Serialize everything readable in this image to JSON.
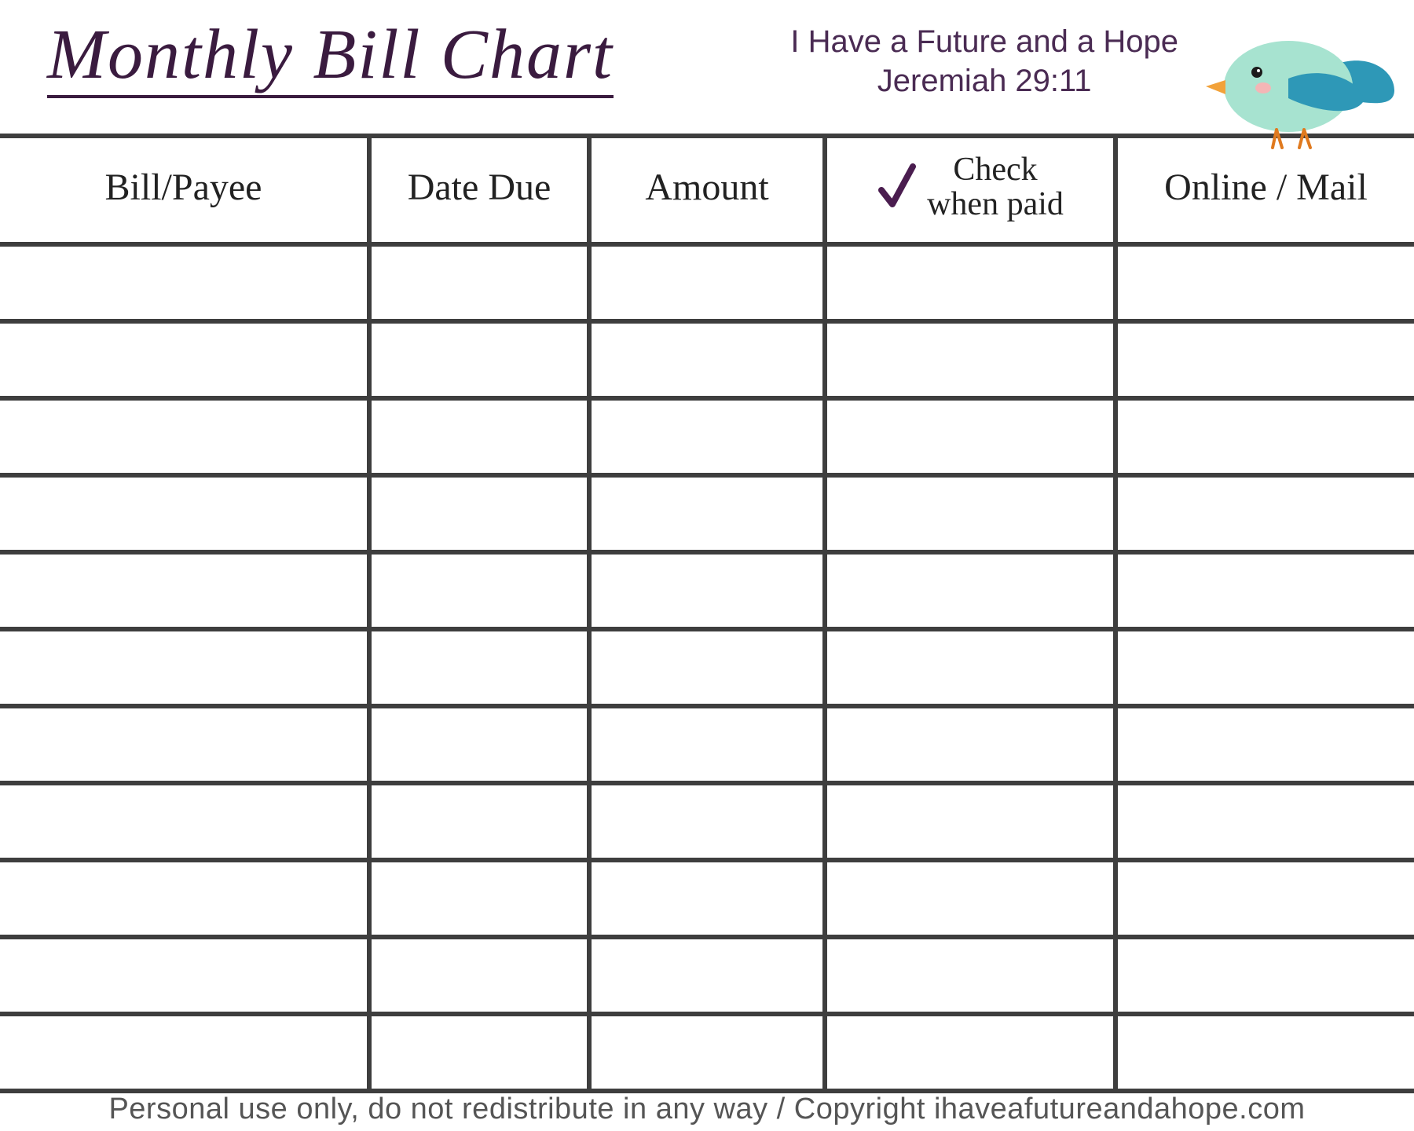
{
  "header": {
    "title": "Monthly Bill Chart",
    "verse_line1": "I Have a Future and a Hope",
    "verse_line2": "Jeremiah 29:11"
  },
  "table": {
    "columns": {
      "bill_payee": "Bill/Payee",
      "date_due": "Date Due",
      "amount": "Amount",
      "check_when_paid_line1": "Check",
      "check_when_paid_line2": "when paid",
      "online_mail": "Online / Mail"
    },
    "rows": [
      {
        "bill_payee": "",
        "date_due": "",
        "amount": "",
        "check": "",
        "online_mail": ""
      },
      {
        "bill_payee": "",
        "date_due": "",
        "amount": "",
        "check": "",
        "online_mail": ""
      },
      {
        "bill_payee": "",
        "date_due": "",
        "amount": "",
        "check": "",
        "online_mail": ""
      },
      {
        "bill_payee": "",
        "date_due": "",
        "amount": "",
        "check": "",
        "online_mail": ""
      },
      {
        "bill_payee": "",
        "date_due": "",
        "amount": "",
        "check": "",
        "online_mail": ""
      },
      {
        "bill_payee": "",
        "date_due": "",
        "amount": "",
        "check": "",
        "online_mail": ""
      },
      {
        "bill_payee": "",
        "date_due": "",
        "amount": "",
        "check": "",
        "online_mail": ""
      },
      {
        "bill_payee": "",
        "date_due": "",
        "amount": "",
        "check": "",
        "online_mail": ""
      },
      {
        "bill_payee": "",
        "date_due": "",
        "amount": "",
        "check": "",
        "online_mail": ""
      },
      {
        "bill_payee": "",
        "date_due": "",
        "amount": "",
        "check": "",
        "online_mail": ""
      },
      {
        "bill_payee": "",
        "date_due": "",
        "amount": "",
        "check": "",
        "online_mail": ""
      }
    ]
  },
  "footer": {
    "text": "Personal use only, do not redistribute in any way / Copyright ihaveafutureandahope.com"
  },
  "colors": {
    "accent_purple": "#3a1b3f",
    "border_gray": "#3e3e3e",
    "bird_body": "#a7e3d0",
    "bird_wing": "#2e98b7",
    "bird_beak": "#f2a23a",
    "bird_legs": "#e07a1f"
  }
}
